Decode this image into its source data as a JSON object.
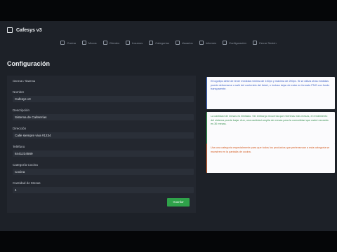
{
  "app": {
    "title": "Cafesys v3"
  },
  "nav": {
    "items": [
      {
        "label": "Cocina",
        "icon": "cocina-icon"
      },
      {
        "label": "Mozos",
        "icon": "mozos-icon"
      },
      {
        "label": "Clientes",
        "icon": "clientes-icon"
      },
      {
        "label": "Insumos",
        "icon": "insumos-icon"
      },
      {
        "label": "Categorías",
        "icon": "categorias-icon"
      },
      {
        "label": "Usuarios",
        "icon": "usuarios-icon"
      },
      {
        "label": "Informes",
        "icon": "informes-icon"
      },
      {
        "label": "Configuración",
        "icon": "configuracion-icon"
      },
      {
        "label": "Cerrar Sesión",
        "icon": "cerrar-sesion-icon"
      }
    ]
  },
  "page": {
    "title": "Configuración"
  },
  "tabs": [
    {
      "label": "General / Sistema",
      "active": true
    },
    {
      "label": "",
      "active": false
    },
    {
      "label": "",
      "active": false
    },
    {
      "label": "",
      "active": false
    },
    {
      "label": "",
      "active": false
    }
  ],
  "form": {
    "fields": [
      {
        "label": "Nombre",
        "value": "Cafesys v3"
      },
      {
        "label": "Descripción",
        "value": "Sistema de Cafeterías"
      },
      {
        "label": "Dirección",
        "value": "Calle siempre viva #1234"
      },
      {
        "label": "Teléfono",
        "value": "8441234569"
      },
      {
        "label": "Categoría Cocina",
        "value": "Cocina"
      },
      {
        "label": "Cantidad de Mesas",
        "value": "4"
      }
    ],
    "save_label": "Guardar"
  },
  "notices": [
    {
      "type": "info",
      "text": "El logotipo debe de tener medidas mínima de 100px y máxima de 200px. Si se utiliza otras medidas puede deformarse o salir del contenido del ticket, o incluso dejar de estar en formato PNG con fondo transparente."
    },
    {
      "type": "success",
      "text": "La cantidad de mesas es ilimitado. Sin embargo recuerda que mientras más mesas, el rendimiento del sistema puede bajar. Aun, una cantidad amplia de mesas para la comodidad que usted necesita es 30 mesas."
    },
    {
      "type": "warning",
      "text": "Usa una categoría especialmente para que todos los productos que pertenezcan a esta categoría se muestren en la pantalla de cocina."
    }
  ],
  "colors": {
    "background": "#1d2128",
    "panel": "#23272f",
    "input": "#2a2f38",
    "save_button": "#2fa24a",
    "info": "#3d6fd8",
    "success": "#35a653",
    "warning": "#e3692b"
  }
}
